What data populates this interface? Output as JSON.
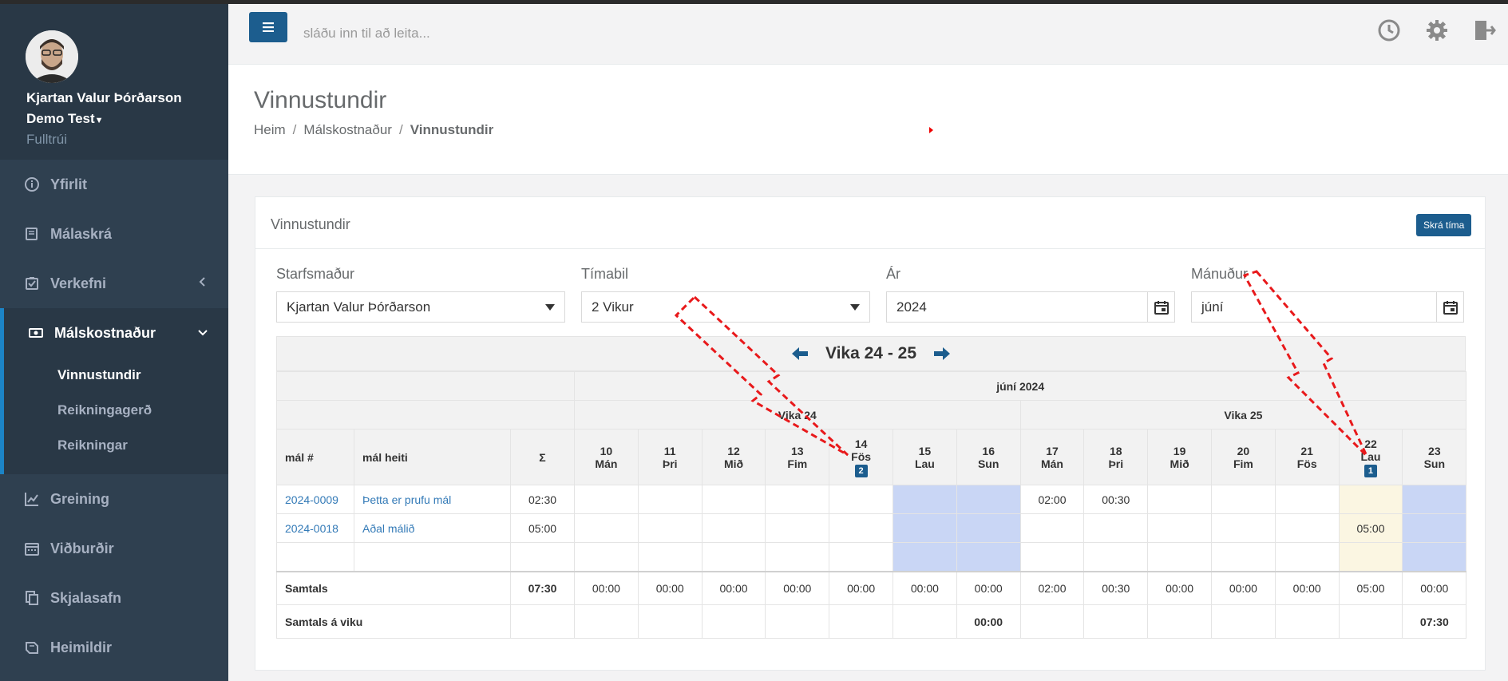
{
  "sidebar": {
    "user_name": "Kjartan Valur Þórðarson",
    "company": "Demo Test",
    "role": "Fulltrúi",
    "items": [
      {
        "label": "Yfirlit",
        "icon": "info-icon"
      },
      {
        "label": "Málaskrá",
        "icon": "book-icon"
      },
      {
        "label": "Verkefni",
        "icon": "checklist-icon"
      }
    ],
    "active_item": {
      "label": "Málskostnaður",
      "icon": "money-icon",
      "subitems": [
        "Vinnustundir",
        "Reikningagerð",
        "Reikningar"
      ]
    },
    "items_after": [
      {
        "label": "Greining",
        "icon": "chart-icon"
      },
      {
        "label": "Viðburðir",
        "icon": "calendar-icon"
      },
      {
        "label": "Skjalasafn",
        "icon": "documents-icon"
      },
      {
        "label": "Heimildir",
        "icon": "book-open-icon"
      }
    ]
  },
  "topbar": {
    "search_placeholder": "sláðu inn til að leita...",
    "icons": [
      "clock-icon",
      "gear-icon",
      "logout-icon"
    ]
  },
  "page": {
    "title": "Vinnustundir",
    "breadcrumb": [
      "Heim",
      "Málskostnaður",
      "Vinnustundir"
    ]
  },
  "panel": {
    "title": "Vinnustundir",
    "add_button": "Skrá tíma",
    "filters": {
      "employee_label": "Starfsmaður",
      "employee_value": "Kjartan Valur Þórðarson",
      "period_label": "Tímabil",
      "period_value": "2 Vikur",
      "year_label": "Ár",
      "year_value": "2024",
      "month_label": "Mánuður",
      "month_value": "júní"
    },
    "week_title": "Vika 24 - 25",
    "month_header": "júní 2024",
    "week_headers": [
      "Vika 24",
      "Vika 25"
    ],
    "col_case_no": "mál #",
    "col_case_name": "mál heiti",
    "col_sum": "Σ",
    "days": [
      {
        "num": "10",
        "name": "Mán"
      },
      {
        "num": "11",
        "name": "Þri"
      },
      {
        "num": "12",
        "name": "Mið"
      },
      {
        "num": "13",
        "name": "Fim"
      },
      {
        "num": "14",
        "name": "Fös",
        "badge": "2"
      },
      {
        "num": "15",
        "name": "Lau"
      },
      {
        "num": "16",
        "name": "Sun"
      },
      {
        "num": "17",
        "name": "Mán"
      },
      {
        "num": "18",
        "name": "Þri"
      },
      {
        "num": "19",
        "name": "Mið"
      },
      {
        "num": "20",
        "name": "Fim"
      },
      {
        "num": "21",
        "name": "Fös"
      },
      {
        "num": "22",
        "name": "Lau",
        "badge": "1"
      },
      {
        "num": "23",
        "name": "Sun"
      }
    ],
    "rows": [
      {
        "case_no": "2024-0009",
        "case_name": "Þetta er prufu mál",
        "sum": "02:30",
        "cells": [
          "",
          "",
          "",
          "",
          "",
          "",
          "",
          "02:00",
          "00:30",
          "",
          "",
          "",
          "",
          ""
        ]
      },
      {
        "case_no": "2024-0018",
        "case_name": "Aðal málið",
        "sum": "05:00",
        "cells": [
          "",
          "",
          "",
          "",
          "",
          "",
          "",
          "",
          "",
          "",
          "",
          "",
          "05:00",
          ""
        ]
      },
      {
        "case_no": "",
        "case_name": "",
        "sum": "",
        "cells": [
          "",
          "",
          "",
          "",
          "",
          "",
          "",
          "",
          "",
          "",
          "",
          "",
          "",
          ""
        ]
      }
    ],
    "totals": {
      "label": "Samtals",
      "sum": "07:30",
      "cells": [
        "00:00",
        "00:00",
        "00:00",
        "00:00",
        "00:00",
        "00:00",
        "00:00",
        "02:00",
        "00:30",
        "00:00",
        "00:00",
        "00:00",
        "05:00",
        "00:00"
      ]
    },
    "week_totals": {
      "label": "Samtals á viku",
      "week1": "00:00",
      "week2": "07:30"
    }
  },
  "colors": {
    "sidebar_bg": "#2f4050",
    "accent": "#1c5d8e",
    "weekend_fill": "#c9d6f5",
    "highlight_fill": "#fbf6e2",
    "annotation": "#e8191b"
  }
}
